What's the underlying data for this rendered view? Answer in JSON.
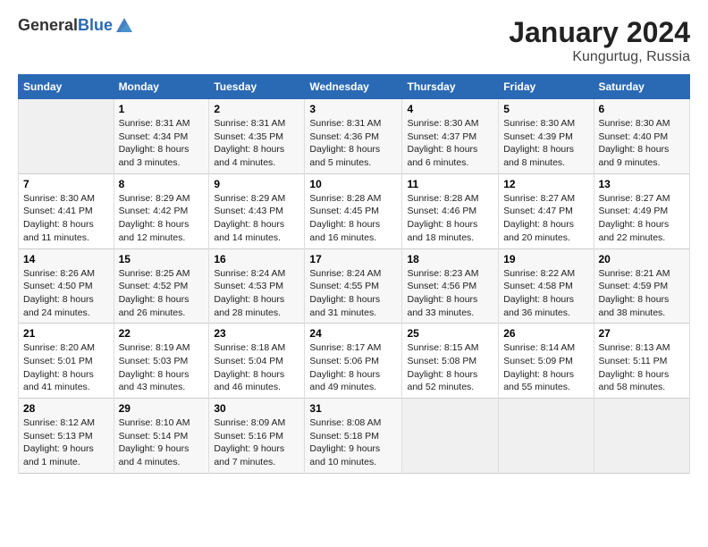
{
  "header": {
    "logo_general": "General",
    "logo_blue": "Blue",
    "title": "January 2024",
    "subtitle": "Kungurtug, Russia"
  },
  "days_of_week": [
    "Sunday",
    "Monday",
    "Tuesday",
    "Wednesday",
    "Thursday",
    "Friday",
    "Saturday"
  ],
  "weeks": [
    [
      {
        "day": "",
        "content": ""
      },
      {
        "day": "1",
        "content": "Sunrise: 8:31 AM\nSunset: 4:34 PM\nDaylight: 8 hours\nand 3 minutes."
      },
      {
        "day": "2",
        "content": "Sunrise: 8:31 AM\nSunset: 4:35 PM\nDaylight: 8 hours\nand 4 minutes."
      },
      {
        "day": "3",
        "content": "Sunrise: 8:31 AM\nSunset: 4:36 PM\nDaylight: 8 hours\nand 5 minutes."
      },
      {
        "day": "4",
        "content": "Sunrise: 8:30 AM\nSunset: 4:37 PM\nDaylight: 8 hours\nand 6 minutes."
      },
      {
        "day": "5",
        "content": "Sunrise: 8:30 AM\nSunset: 4:39 PM\nDaylight: 8 hours\nand 8 minutes."
      },
      {
        "day": "6",
        "content": "Sunrise: 8:30 AM\nSunset: 4:40 PM\nDaylight: 8 hours\nand 9 minutes."
      }
    ],
    [
      {
        "day": "7",
        "content": "Sunrise: 8:30 AM\nSunset: 4:41 PM\nDaylight: 8 hours\nand 11 minutes."
      },
      {
        "day": "8",
        "content": "Sunrise: 8:29 AM\nSunset: 4:42 PM\nDaylight: 8 hours\nand 12 minutes."
      },
      {
        "day": "9",
        "content": "Sunrise: 8:29 AM\nSunset: 4:43 PM\nDaylight: 8 hours\nand 14 minutes."
      },
      {
        "day": "10",
        "content": "Sunrise: 8:28 AM\nSunset: 4:45 PM\nDaylight: 8 hours\nand 16 minutes."
      },
      {
        "day": "11",
        "content": "Sunrise: 8:28 AM\nSunset: 4:46 PM\nDaylight: 8 hours\nand 18 minutes."
      },
      {
        "day": "12",
        "content": "Sunrise: 8:27 AM\nSunset: 4:47 PM\nDaylight: 8 hours\nand 20 minutes."
      },
      {
        "day": "13",
        "content": "Sunrise: 8:27 AM\nSunset: 4:49 PM\nDaylight: 8 hours\nand 22 minutes."
      }
    ],
    [
      {
        "day": "14",
        "content": "Sunrise: 8:26 AM\nSunset: 4:50 PM\nDaylight: 8 hours\nand 24 minutes."
      },
      {
        "day": "15",
        "content": "Sunrise: 8:25 AM\nSunset: 4:52 PM\nDaylight: 8 hours\nand 26 minutes."
      },
      {
        "day": "16",
        "content": "Sunrise: 8:24 AM\nSunset: 4:53 PM\nDaylight: 8 hours\nand 28 minutes."
      },
      {
        "day": "17",
        "content": "Sunrise: 8:24 AM\nSunset: 4:55 PM\nDaylight: 8 hours\nand 31 minutes."
      },
      {
        "day": "18",
        "content": "Sunrise: 8:23 AM\nSunset: 4:56 PM\nDaylight: 8 hours\nand 33 minutes."
      },
      {
        "day": "19",
        "content": "Sunrise: 8:22 AM\nSunset: 4:58 PM\nDaylight: 8 hours\nand 36 minutes."
      },
      {
        "day": "20",
        "content": "Sunrise: 8:21 AM\nSunset: 4:59 PM\nDaylight: 8 hours\nand 38 minutes."
      }
    ],
    [
      {
        "day": "21",
        "content": "Sunrise: 8:20 AM\nSunset: 5:01 PM\nDaylight: 8 hours\nand 41 minutes."
      },
      {
        "day": "22",
        "content": "Sunrise: 8:19 AM\nSunset: 5:03 PM\nDaylight: 8 hours\nand 43 minutes."
      },
      {
        "day": "23",
        "content": "Sunrise: 8:18 AM\nSunset: 5:04 PM\nDaylight: 8 hours\nand 46 minutes."
      },
      {
        "day": "24",
        "content": "Sunrise: 8:17 AM\nSunset: 5:06 PM\nDaylight: 8 hours\nand 49 minutes."
      },
      {
        "day": "25",
        "content": "Sunrise: 8:15 AM\nSunset: 5:08 PM\nDaylight: 8 hours\nand 52 minutes."
      },
      {
        "day": "26",
        "content": "Sunrise: 8:14 AM\nSunset: 5:09 PM\nDaylight: 8 hours\nand 55 minutes."
      },
      {
        "day": "27",
        "content": "Sunrise: 8:13 AM\nSunset: 5:11 PM\nDaylight: 8 hours\nand 58 minutes."
      }
    ],
    [
      {
        "day": "28",
        "content": "Sunrise: 8:12 AM\nSunset: 5:13 PM\nDaylight: 9 hours\nand 1 minute."
      },
      {
        "day": "29",
        "content": "Sunrise: 8:10 AM\nSunset: 5:14 PM\nDaylight: 9 hours\nand 4 minutes."
      },
      {
        "day": "30",
        "content": "Sunrise: 8:09 AM\nSunset: 5:16 PM\nDaylight: 9 hours\nand 7 minutes."
      },
      {
        "day": "31",
        "content": "Sunrise: 8:08 AM\nSunset: 5:18 PM\nDaylight: 9 hours\nand 10 minutes."
      },
      {
        "day": "",
        "content": ""
      },
      {
        "day": "",
        "content": ""
      },
      {
        "day": "",
        "content": ""
      }
    ]
  ]
}
